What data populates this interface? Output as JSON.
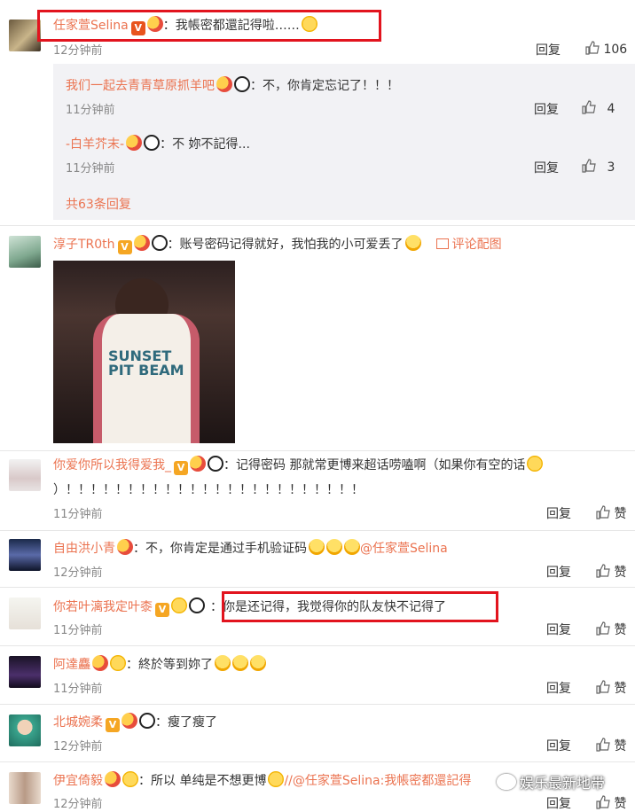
{
  "c1": {
    "user": "任家萱Selina",
    "text": "：我帳密都還記得啦……",
    "time": "12分钟前",
    "reply": "回复",
    "likes": "106"
  },
  "r1": {
    "user": "我们一起去青青草原抓羊吧",
    "text": "：不，你肯定忘记了！！！",
    "time": "11分钟前",
    "reply": "回复",
    "likes": "4"
  },
  "r2": {
    "user": "-白羊芥末-",
    "text": "：不 妳不記得...",
    "time": "11分钟前",
    "reply": "回复",
    "likes": "3"
  },
  "more": "共63条回复",
  "c2": {
    "user": "淳子TR0th",
    "text": "：账号密码记得就好，我怕我的小可爱丢了",
    "pic_link": "评论配图",
    "photo_text": "SUNSET PIT BEAM"
  },
  "c3": {
    "user": "你爱你所以我得爱我_",
    "text": "：记得密码 那就常更博来超话唠嗑啊（如果你有空的话",
    "text2": "）！！！！！！！！！！！！！！！！！！！！！！！！",
    "time": "11分钟前",
    "reply": "回复",
    "like": "赞"
  },
  "c4": {
    "user": "自由洪小青",
    "text": "：不，你肯定是通过手机验证码",
    "mention": "@任家萱Selina",
    "time": "12分钟前",
    "reply": "回复",
    "like": "赞"
  },
  "c5": {
    "user": "你若叶漓我定叶桼",
    "text": "：你是还记得，我觉得你的队友快不记得了",
    "time": "11分钟前",
    "reply": "回复",
    "like": "赞"
  },
  "c6": {
    "user": "阿達麤",
    "text": "：終於等到妳了",
    "time": "11分钟前",
    "reply": "回复",
    "like": "赞"
  },
  "c7": {
    "user": "北城婉柔",
    "text": "：瘦了瘦了",
    "time": "12分钟前",
    "reply": "回复",
    "like": "赞"
  },
  "c8": {
    "user": "伊宜倚毅",
    "text": "：所以 单纯是不想更博",
    "mention": "//@任家萱Selina:我帳密都還記得",
    "time": "12分钟前",
    "reply": "回复",
    "like": "赞"
  },
  "watermark": "娱乐最新地带",
  "colors": {
    "accent": "#eb7350",
    "highlight": "#e2141e"
  }
}
